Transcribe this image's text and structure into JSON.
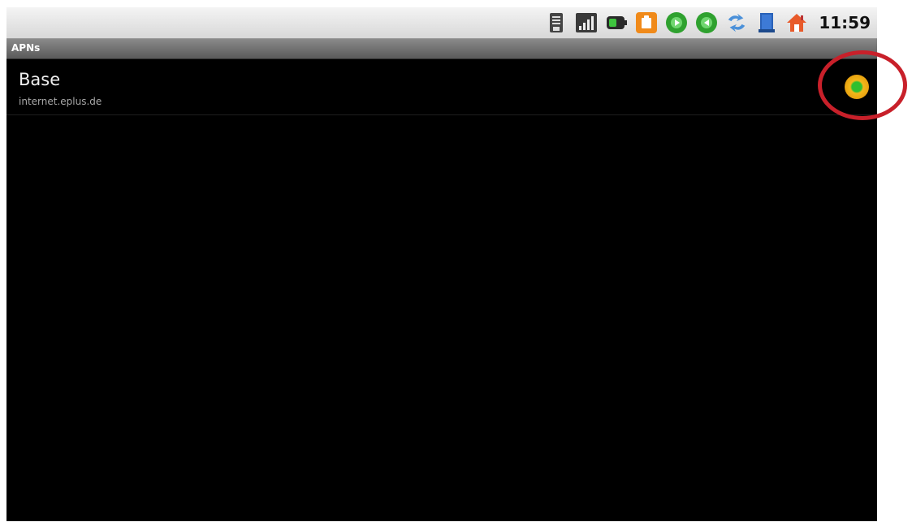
{
  "status_bar": {
    "time": "11:59",
    "icons": [
      "sd-card-icon",
      "signal-strength-icon",
      "battery-icon",
      "notification-orange-icon",
      "green-app-icon",
      "green-app-icon-2",
      "usb-sync-icon",
      "book-icon",
      "home-icon"
    ]
  },
  "title_bar": {
    "title": "APNs"
  },
  "apn_list": [
    {
      "name": "Base",
      "url": "internet.eplus.de",
      "selected": true
    }
  ],
  "colors": {
    "background": "#000000",
    "radio_selected_outer": "#e8a10f",
    "radio_selected_inner": "#2fbf2f",
    "annotation": "#c8202a"
  }
}
